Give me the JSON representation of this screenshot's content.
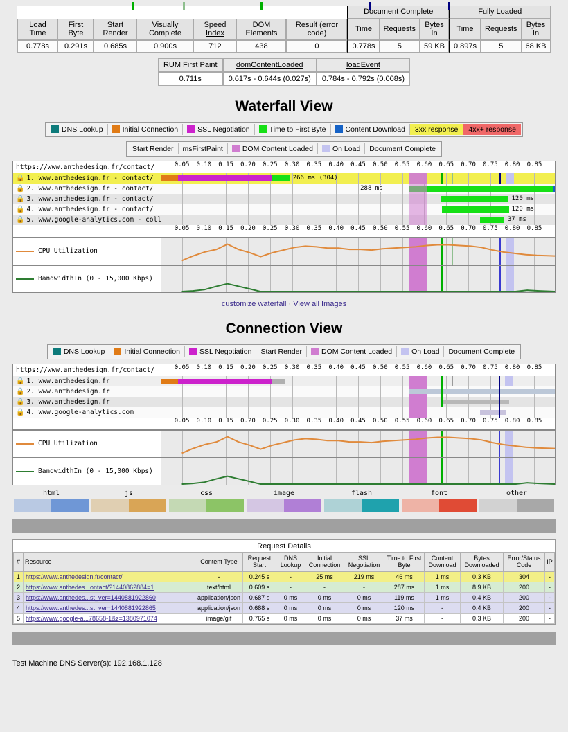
{
  "summary": {
    "group_headers": [
      "Document Complete",
      "Fully Loaded"
    ],
    "columns": [
      "Load Time",
      "First Byte",
      "Start Render",
      "Visually Complete",
      "Speed Index",
      "DOM Elements",
      "Result (error code)"
    ],
    "subcolumns": [
      "Time",
      "Requests",
      "Bytes In",
      "Time",
      "Requests",
      "Bytes In"
    ],
    "values": [
      "0.778s",
      "0.291s",
      "0.685s",
      "0.900s",
      "712",
      "438",
      "0"
    ],
    "doc_complete": [
      "0.778s",
      "5",
      "59 KB"
    ],
    "fully_loaded": [
      "0.897s",
      "5",
      "68 KB"
    ]
  },
  "rum": {
    "headers": [
      "RUM First Paint",
      "domContentLoaded",
      "loadEvent"
    ],
    "values": [
      "0.711s",
      "0.617s - 0.644s (0.027s)",
      "0.784s - 0.792s (0.008s)"
    ]
  },
  "waterfall": {
    "title": "Waterfall View",
    "legend_top": [
      {
        "label": "DNS Lookup",
        "color": "#0d7b7b"
      },
      {
        "label": "Initial Connection",
        "color": "#e07b16"
      },
      {
        "label": "SSL Negotiation",
        "color": "#cc22cc"
      },
      {
        "label": "Time to First Byte",
        "color": "#16e016"
      },
      {
        "label": "Content Download",
        "color": "#1562c6"
      },
      {
        "label": "3xx response",
        "color": "#f2ef50"
      },
      {
        "label": "4xx+ response",
        "color": "#f06868"
      }
    ],
    "legend_bottom": [
      {
        "label": "Start Render",
        "color": "#00b000",
        "type": "bar"
      },
      {
        "label": "msFirstPaint",
        "color": "#8fbf8f",
        "type": "bar"
      },
      {
        "label": "DOM Content Loaded",
        "color": "#d07dd0",
        "type": "box"
      },
      {
        "label": "On Load",
        "color": "#c3c3f0",
        "type": "box"
      },
      {
        "label": "Document Complete",
        "color": "#000080",
        "type": "bar"
      }
    ],
    "url_header": "https://www.anthedesign.fr/contact/",
    "axis_ticks": [
      "0.05",
      "0.10",
      "0.15",
      "0.20",
      "0.25",
      "0.30",
      "0.35",
      "0.40",
      "0.45",
      "0.50",
      "0.55",
      "0.60",
      "0.65",
      "0.70",
      "0.75",
      "0.80",
      "0.85"
    ],
    "rows": [
      {
        "n": "1.",
        "label": "www.anthedesign.fr - contact/",
        "annotation": "266 ms (304)"
      },
      {
        "n": "2.",
        "label": "www.anthedesign.fr - contact/",
        "annotation": "288 ms"
      },
      {
        "n": "3.",
        "label": "www.anthedesign.fr - contact/",
        "annotation": "120 ms"
      },
      {
        "n": "4.",
        "label": "www.anthedesign.fr - contact/",
        "annotation": "120 ms"
      },
      {
        "n": "5.",
        "label": "www.google-analytics.com - collect",
        "annotation": "37 ms"
      }
    ],
    "cpu_label": "CPU Utilization",
    "bandwidth_label": "BandwidthIn (0 - 15,000 Kbps)"
  },
  "links": {
    "customize": "customize waterfall",
    "separator": "·",
    "view_images": "View all Images"
  },
  "connection": {
    "title": "Connection View",
    "legend": [
      {
        "label": "DNS Lookup",
        "color": "#0d7b7b",
        "type": "box"
      },
      {
        "label": "Initial Connection",
        "color": "#e07b16",
        "type": "box"
      },
      {
        "label": "SSL Negotiation",
        "color": "#cc22cc",
        "type": "box"
      },
      {
        "label": "Start Render",
        "color": "#00b000",
        "type": "bar"
      },
      {
        "label": "DOM Content Loaded",
        "color": "#d07dd0",
        "type": "box"
      },
      {
        "label": "On Load",
        "color": "#c3c3f0",
        "type": "box"
      },
      {
        "label": "Document Complete",
        "color": "#000080",
        "type": "bar"
      }
    ],
    "url_header": "https://www.anthedesign.fr/contact/",
    "axis_ticks": [
      "0.05",
      "0.10",
      "0.15",
      "0.20",
      "0.25",
      "0.30",
      "0.35",
      "0.40",
      "0.45",
      "0.50",
      "0.55",
      "0.60",
      "0.65",
      "0.70",
      "0.75",
      "0.80",
      "0.85"
    ],
    "rows": [
      {
        "n": "1.",
        "label": "www.anthedesign.fr"
      },
      {
        "n": "2.",
        "label": "www.anthedesign.fr"
      },
      {
        "n": "3.",
        "label": "www.anthedesign.fr"
      },
      {
        "n": "4.",
        "label": "www.google-analytics.com"
      }
    ],
    "cpu_label": "CPU Utilization",
    "bandwidth_label": "BandwidthIn (0 - 15,000 Kbps)"
  },
  "content_types": [
    {
      "name": "html",
      "c1": "#b9c9e3",
      "c2": "#6f97d6"
    },
    {
      "name": "js",
      "c1": "#e0cfb2",
      "c2": "#d9a košt"
    },
    {
      "name": "css",
      "c1": "#c4d9b4",
      "c2": "#8cc濃"
    },
    {
      "name": "image",
      "c1": "#d4c6e3",
      "c2": "#b07fd6"
    },
    {
      "name": "flash",
      "c1": "#aed2d6",
      "c2": "#1fa2ad"
    },
    {
      "name": "font",
      "c1": "#eeb3a6",
      "c2": "#e04b35"
    },
    {
      "name": "other",
      "c1": "#d2d2d2",
      "c2": "#a8a8a8"
    }
  ],
  "request_details": {
    "title": "Request Details",
    "columns": [
      "#",
      "Resource",
      "Content Type",
      "Request Start",
      "DNS Lookup",
      "Initial Connection",
      "SSL Negotiation",
      "Time to First Byte",
      "Content Download",
      "Bytes Downloaded",
      "Error/Status Code",
      "IP"
    ],
    "rows": [
      {
        "n": "1",
        "resource": "https://www.anthedesign.fr/contact/",
        "content_type": "-",
        "request_start": "0.245 s",
        "dns_lookup": "-",
        "initial_connection": "25 ms",
        "ssl_negotiation": "219 ms",
        "ttfb": "46 ms",
        "content_download": "1 ms",
        "bytes": "0.3 KB",
        "status": "304",
        "ip": "-"
      },
      {
        "n": "2",
        "resource": "https://www.anthedes...ontact/?1440862884=1",
        "content_type": "text/html",
        "request_start": "0.609 s",
        "dns_lookup": "-",
        "initial_connection": "-",
        "ssl_negotiation": "-",
        "ttfb": "287 ms",
        "content_download": "1 ms",
        "bytes": "8.9 KB",
        "status": "200",
        "ip": "-"
      },
      {
        "n": "3",
        "resource": "https://www.anthedes...st_ver=1440881922860",
        "content_type": "application/json",
        "request_start": "0.687 s",
        "dns_lookup": "0 ms",
        "initial_connection": "0 ms",
        "ssl_negotiation": "0 ms",
        "ttfb": "119 ms",
        "content_download": "1 ms",
        "bytes": "0.4 KB",
        "status": "200",
        "ip": "-"
      },
      {
        "n": "4",
        "resource": "https://www.anthedes...st_ver=1440881922865",
        "content_type": "application/json",
        "request_start": "0.688 s",
        "dns_lookup": "0 ms",
        "initial_connection": "0 ms",
        "ssl_negotiation": "0 ms",
        "ttfb": "120 ms",
        "content_download": "-",
        "bytes": "0.4 KB",
        "status": "200",
        "ip": "-"
      },
      {
        "n": "5",
        "resource": "https://www.google-a...78658-1&z=1380971074",
        "content_type": "image/gif",
        "request_start": "0.765 s",
        "dns_lookup": "0 ms",
        "initial_connection": "0 ms",
        "ssl_negotiation": "0 ms",
        "ttfb": "37 ms",
        "content_download": "-",
        "bytes": "0.3 KB",
        "status": "200",
        "ip": "-"
      }
    ]
  },
  "footer": {
    "dns_server": "Test Machine DNS Server(s): 192.168.1.128"
  }
}
